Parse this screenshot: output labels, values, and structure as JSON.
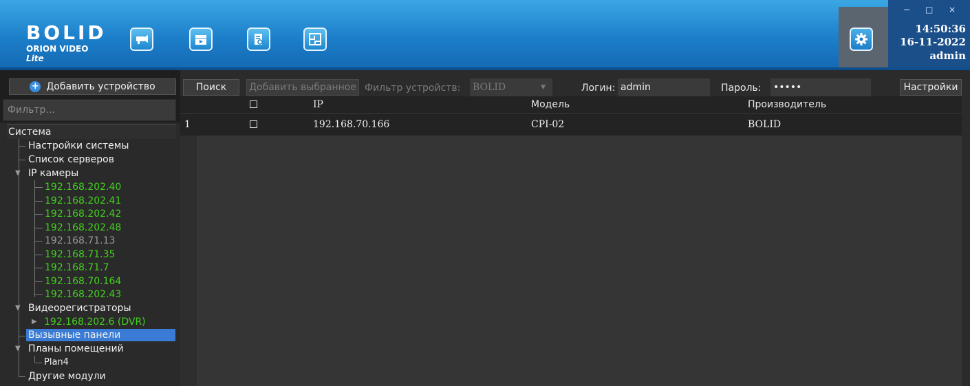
{
  "header": {
    "logo_brand": "BOLID",
    "logo_sub": "ORION VIDEO",
    "logo_sub_italic": "Lite",
    "toolbar_icons": [
      "camera-icon",
      "video-archive-icon",
      "report-icon",
      "floor-plan-icon"
    ],
    "settings_icon": "gear-icon",
    "window_controls": [
      "−",
      "□",
      "×"
    ],
    "time": "14:50:36",
    "date": "16-11-2022",
    "user": "admin"
  },
  "sidebar": {
    "add_device_label": "Добавить устройство",
    "filter_placeholder": "Фильтр...",
    "tree": {
      "root": "Система",
      "system_settings": "Настройки системы",
      "server_list": "Список серверов",
      "ip_cameras": "IP камеры",
      "cameras": [
        {
          "label": "192.168.202.40",
          "status": "online"
        },
        {
          "label": "192.168.202.41",
          "status": "online"
        },
        {
          "label": "192.168.202.42",
          "status": "online"
        },
        {
          "label": "192.168.202.48",
          "status": "online"
        },
        {
          "label": "192.168.71.13",
          "status": "offline"
        },
        {
          "label": "192.168.71.35",
          "status": "online"
        },
        {
          "label": "192.168.71.7",
          "status": "online"
        },
        {
          "label": "192.168.70.164",
          "status": "online"
        },
        {
          "label": "192.168.202.43",
          "status": "online"
        }
      ],
      "nvrs": "Видеорегистраторы",
      "dvr": "192.168.202.6 (DVR)",
      "call_panels": "Вызывные панели",
      "floor_plans": "Планы помещений",
      "plan": "Plan4",
      "other_modules": "Другие модули"
    }
  },
  "toolbar": {
    "search_label": "Поиск",
    "add_selected_label": "Добавить выбранное",
    "device_filter_label": "Фильтр устройств:",
    "vendor_value": "BOLID",
    "login_label": "Логин:",
    "login_value": "admin",
    "password_label": "Пароль:",
    "password_value": "•••••",
    "settings_label": "Настройки"
  },
  "table": {
    "columns": [
      "",
      "IP",
      "Модель",
      "Производитель"
    ],
    "rows": [
      {
        "num": "1",
        "checked": false,
        "ip": "192.168.70.166",
        "model": "CPI-02",
        "vendor": "BOLID"
      }
    ]
  },
  "colors": {
    "header_blue": "#1c7ec9",
    "online_green": "#43d11e",
    "offline_gray": "#9a9a9a",
    "selection_blue": "#3a7bd5"
  }
}
